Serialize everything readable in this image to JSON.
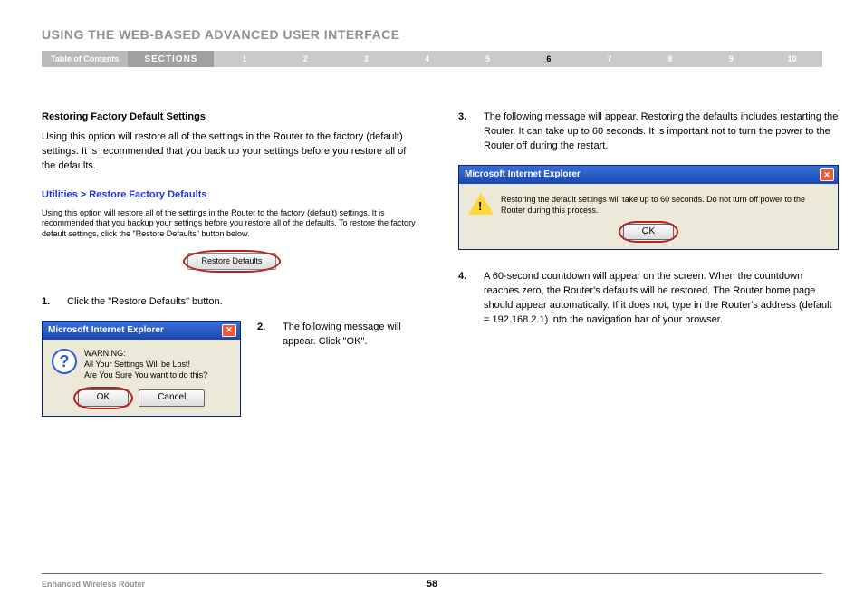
{
  "header": {
    "title": "USING THE WEB-BASED ADVANCED USER INTERFACE"
  },
  "nav": {
    "toc": "Table of Contents",
    "sections_label": "SECTIONS",
    "items": [
      "1",
      "2",
      "3",
      "4",
      "5",
      "6",
      "7",
      "8",
      "9",
      "10"
    ],
    "active_index": 5
  },
  "left": {
    "subhead": "Restoring Factory Default Settings",
    "intro": "Using this option will restore all of the settings in the Router to the factory (default) settings. It is recommended that you back up your settings before you restore all of the defaults.",
    "util_heading": "Utilities > Restore Factory Defaults",
    "util_text": "Using this option will restore all of the settings in the Router to the factory (default) settings. It is recommended that you backup your settings before you restore all of the defaults. To restore the factory default settings, click the \"Restore Defaults\" button below.",
    "restore_button": "Restore Defaults",
    "step1_num": "1.",
    "step1_text": "Click the \"Restore Defaults\" button.",
    "step2_num": "2.",
    "step2_text": "The following message will appear. Click \"OK\".",
    "dialog1": {
      "title": "Microsoft Internet Explorer",
      "message": "WARNING:\nAll Your Settings Will be Lost!\nAre You Sure You want to do this?",
      "ok": "OK",
      "cancel": "Cancel"
    }
  },
  "right": {
    "step3_num": "3.",
    "step3_text": "The following message will appear. Restoring the defaults includes restarting the Router. It can take up to 60 seconds. It is important not to turn the power to the Router off during the restart.",
    "dialog2": {
      "title": "Microsoft Internet Explorer",
      "message": "Restoring the default settings will take up to 60 seconds. Do not turn off power to the Router during this process.",
      "ok": "OK"
    },
    "step4_num": "4.",
    "step4_text": "A 60-second countdown will appear on the screen. When the countdown reaches zero, the Router's defaults will be restored. The Router home page should appear automatically. If it does not, type in the Router's address (default = 192.168.2.1) into the navigation bar of your browser."
  },
  "footer": {
    "product": "Enhanced Wireless Router",
    "page": "58"
  }
}
